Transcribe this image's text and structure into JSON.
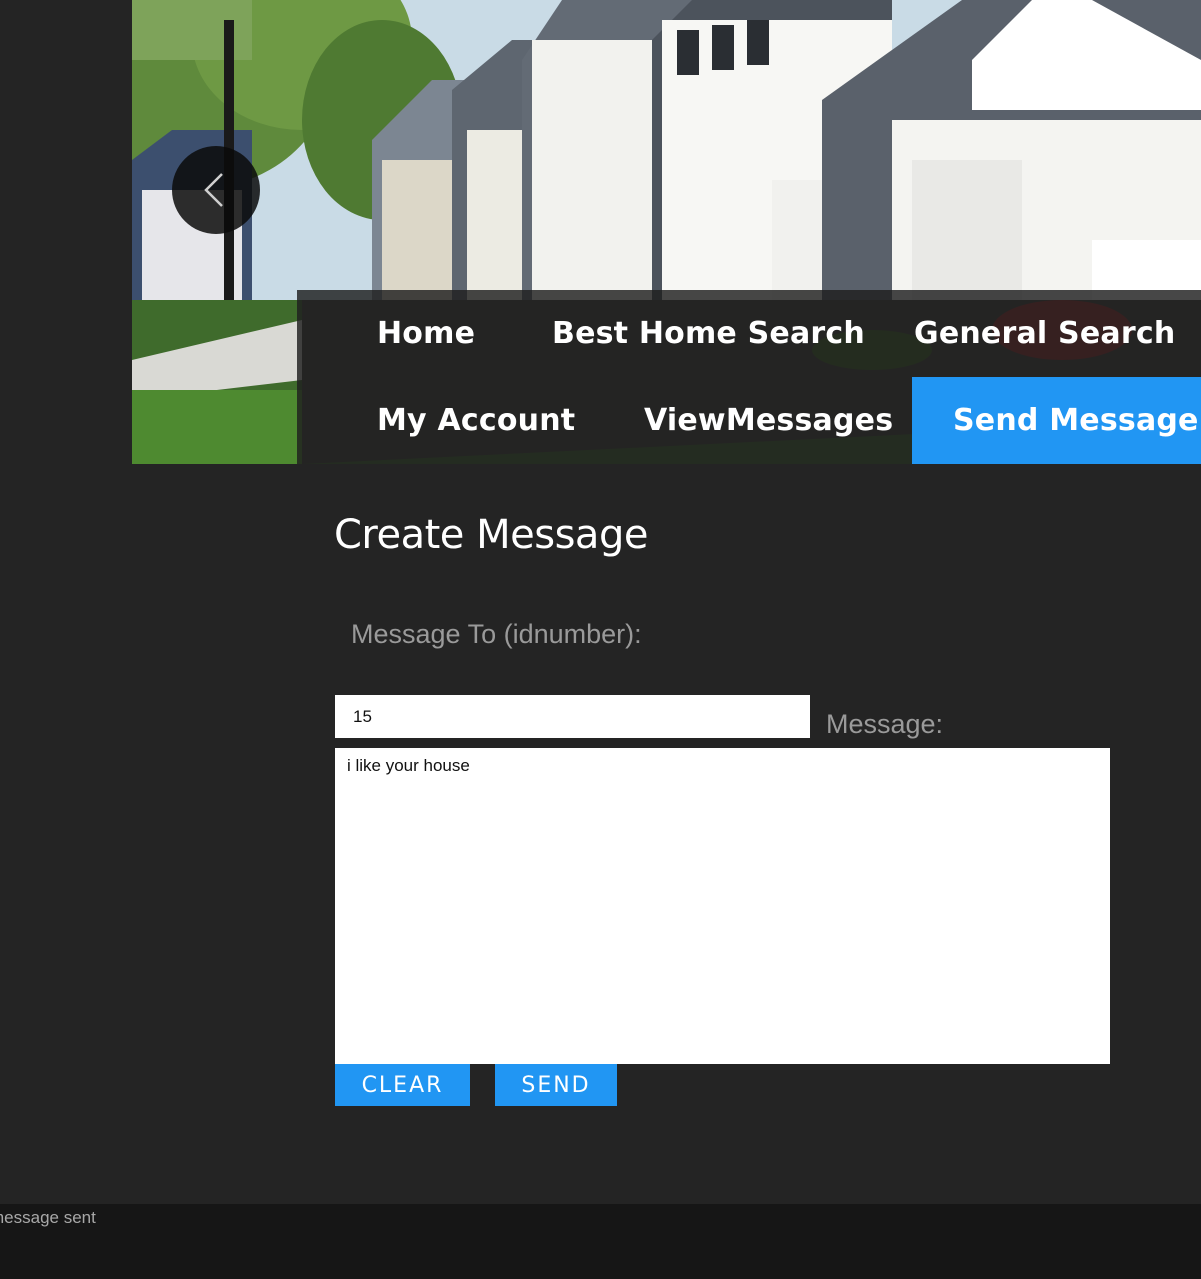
{
  "header": {
    "prev_icon": "chevron-left-icon",
    "hero_image": "suburban-houses-photo"
  },
  "nav": {
    "items": [
      {
        "label": "Home",
        "active": false
      },
      {
        "label": "Best Home Search",
        "active": false
      },
      {
        "label": "General Search",
        "active": false
      },
      {
        "label": "My Account",
        "active": false
      },
      {
        "label": "ViewMessages",
        "active": false
      },
      {
        "label": "Send Message",
        "active": true
      }
    ],
    "active_color": "#2196f3"
  },
  "form": {
    "title": "Create Message",
    "to_label": "Message To (idnumber):",
    "to_value": "15",
    "message_label": "Message:",
    "message_value": "i like your house",
    "clear_label": "CLEAR",
    "send_label": "SEND"
  },
  "footer": {
    "status": "message sent"
  },
  "colors": {
    "background": "#242424",
    "footer": "#161616",
    "accent": "#2196f3",
    "label": "#9a9a9a"
  }
}
